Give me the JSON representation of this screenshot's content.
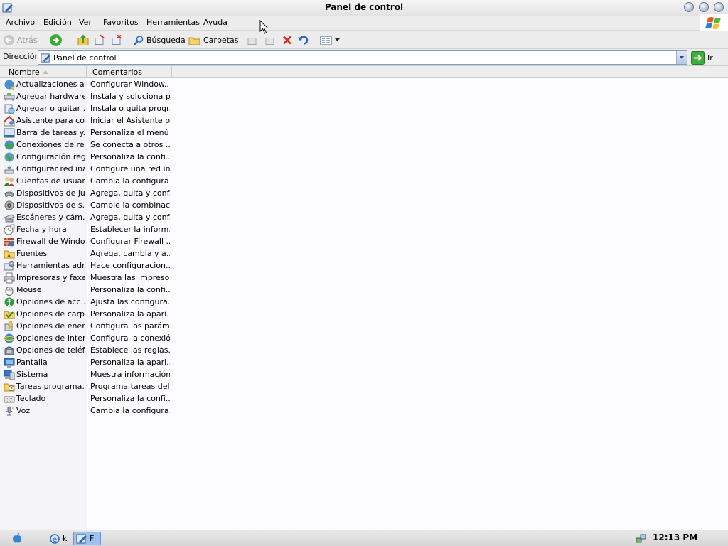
{
  "window": {
    "title": "Panel de control"
  },
  "menubar": [
    "Archivo",
    "Edición",
    "Ver",
    "Favoritos",
    "Herramientas",
    "Ayuda"
  ],
  "toolbar": {
    "back": "Atrás",
    "search": "Búsqueda",
    "folders": "Carpetas"
  },
  "address": {
    "label": "Dirección",
    "value": "Panel de control",
    "go": "Ir"
  },
  "columns": {
    "name": "Nombre",
    "comments": "Comentarios"
  },
  "items": [
    {
      "name": "Actualizaciones a...",
      "comment": "Configurar Window...",
      "icon": "globe-update-icon"
    },
    {
      "name": "Agregar hardware",
      "comment": "Instala y soluciona p...",
      "icon": "hardware-icon"
    },
    {
      "name": "Agregar o quitar ...",
      "comment": "Instala o quita progr...",
      "icon": "add-remove-icon"
    },
    {
      "name": "Asistente para co...",
      "comment": "Iniciar el Asistente p...",
      "icon": "wizard-icon"
    },
    {
      "name": "Barra de tareas y...",
      "comment": "Personaliza el menú ...",
      "icon": "taskbar-icon"
    },
    {
      "name": "Conexiones de red",
      "comment": "Se conecta a otros ...",
      "icon": "network-icon"
    },
    {
      "name": "Configuración reg...",
      "comment": "Personaliza la confi...",
      "icon": "regional-globe-icon"
    },
    {
      "name": "Configurar red ina...",
      "comment": "Configure una red in...",
      "icon": "wireless-icon"
    },
    {
      "name": "Cuentas de usuario",
      "comment": "Cambia la configura...",
      "icon": "users-icon"
    },
    {
      "name": "Dispositivos de ju...",
      "comment": "Agrega, quita y conf...",
      "icon": "gamepad-icon"
    },
    {
      "name": "Dispositivos de s...",
      "comment": "Cambie la combinaci...",
      "icon": "speaker-icon"
    },
    {
      "name": "Escáneres y cám...",
      "comment": "Agrega, quita y conf...",
      "icon": "scanner-icon"
    },
    {
      "name": "Fecha y hora",
      "comment": "Establecer la inform...",
      "icon": "clock-icon"
    },
    {
      "name": "Firewall de Windo...",
      "comment": "Configurar Firewall ...",
      "icon": "firewall-icon"
    },
    {
      "name": "Fuentes",
      "comment": "Agrega, cambia y a...",
      "icon": "fonts-folder-icon"
    },
    {
      "name": "Herramientas adm...",
      "comment": "Hace configuracion...",
      "icon": "admin-tools-icon"
    },
    {
      "name": "Impresoras y faxes",
      "comment": "Muestra las impreso...",
      "icon": "printer-icon"
    },
    {
      "name": "Mouse",
      "comment": "Personaliza la confi...",
      "icon": "mouse-icon"
    },
    {
      "name": "Opciones de acc...",
      "comment": "Ajusta las configura...",
      "icon": "accessibility-icon"
    },
    {
      "name": "Opciones de carp...",
      "comment": "Personaliza la apari...",
      "icon": "folder-options-icon"
    },
    {
      "name": "Opciones de ener...",
      "comment": "Configura los parám...",
      "icon": "power-icon"
    },
    {
      "name": "Opciones de Inter...",
      "comment": "Configura la conexió...",
      "icon": "internet-globe-icon"
    },
    {
      "name": "Opciones de teléf...",
      "comment": "Establece las reglas...",
      "icon": "phone-icon"
    },
    {
      "name": "Pantalla",
      "comment": "Personaliza la apari...",
      "icon": "display-icon"
    },
    {
      "name": "Sistema",
      "comment": "Muestra información...",
      "icon": "system-icon"
    },
    {
      "name": "Tareas programa...",
      "comment": "Programa tareas del...",
      "icon": "scheduled-tasks-icon"
    },
    {
      "name": "Teclado",
      "comment": "Personaliza la confi...",
      "icon": "keyboard-icon"
    },
    {
      "name": "Voz",
      "comment": "Cambia la configura...",
      "icon": "speech-icon"
    }
  ],
  "taskbar": {
    "buttons": [
      {
        "label": "k",
        "icon": "ie-icon",
        "active": false
      },
      {
        "label": "F",
        "icon": "control-panel-icon",
        "active": true
      }
    ]
  },
  "tray": {
    "clock": "12:13 PM"
  }
}
